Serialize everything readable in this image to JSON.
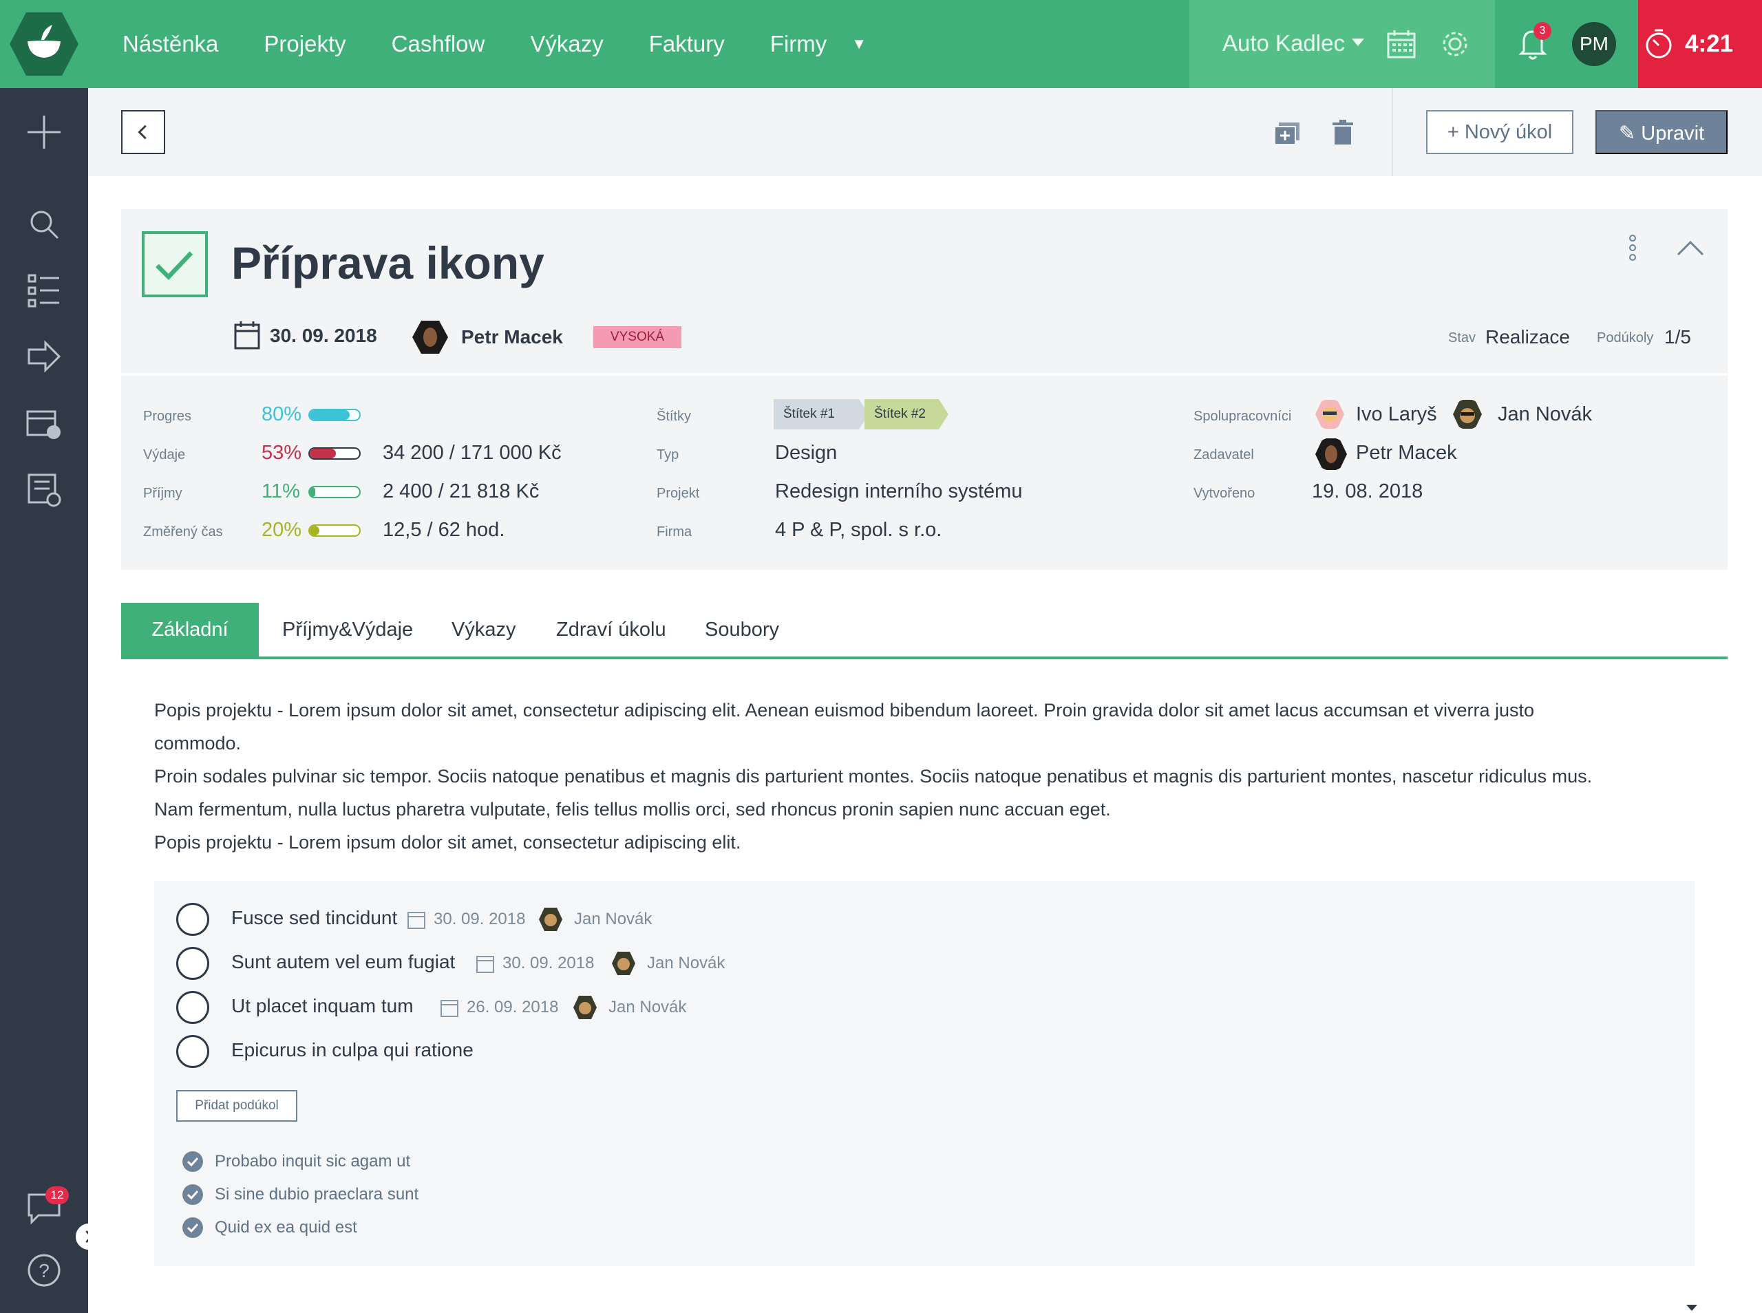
{
  "nav": {
    "items": [
      "Nástěnka",
      "Projekty",
      "Cashflow",
      "Výkazy",
      "Faktury",
      "Firmy"
    ],
    "company": "Auto Kadlec",
    "notifications_count": "3",
    "user_initials": "PM",
    "timer": "4:21"
  },
  "sidebar": {
    "icons": [
      "plus-icon",
      "search-icon",
      "tasks-list-icon",
      "forward-icon",
      "billing-icon",
      "report-icon"
    ],
    "chat_count": "12"
  },
  "toolbar": {
    "new_task_label": "+ Nový úkol",
    "edit_label": "Upravit"
  },
  "task": {
    "title": "Příprava ikony",
    "date": "30. 09. 2018",
    "owner": "Petr Macek",
    "priority": "VYSOKÁ",
    "stav_label": "Stav",
    "stav_value": "Realizace",
    "subtasks_label": "Podúkoly",
    "subtasks_value": "1/5"
  },
  "stats": {
    "progres": {
      "label": "Progres",
      "pct": "80%",
      "fill": 0.8,
      "color": "#3cc3d6"
    },
    "vydaje": {
      "label": "Výdaje",
      "pct": "53%",
      "fill": 0.53,
      "value": "34 200 / 171 000 Kč",
      "color": "#c4314b"
    },
    "prijmy": {
      "label": "Příjmy",
      "pct": "11%",
      "fill": 0.11,
      "value": "2 400 / 21 818 Kč",
      "color": "#3fb07a"
    },
    "cas": {
      "label": "Změřený čas",
      "pct": "20%",
      "fill": 0.2,
      "value": "12,5 / 62 hod.",
      "color": "#a8b420"
    }
  },
  "meta": {
    "stitky_label": "Štítky",
    "tags": [
      "Štítek #1",
      "Štítek #2"
    ],
    "typ_label": "Typ",
    "typ_value": "Design",
    "projekt_label": "Projekt",
    "projekt_value": "Redesign interního systému",
    "firma_label": "Firma",
    "firma_value": "4 P & P, spol. s r.o.",
    "spol_label": "Spolupracovníci",
    "collaborators": [
      "Ivo Laryš",
      "Jan Novák"
    ],
    "zadavatel_label": "Zadavatel",
    "zadavatel_value": "Petr Macek",
    "vytvoreno_label": "Vytvořeno",
    "vytvoreno_value": "19. 08. 2018"
  },
  "tabs": [
    "Základní",
    "Příjmy&Výdaje",
    "Výkazy",
    "Zdraví úkolu",
    "Soubory"
  ],
  "description": [
    "Popis projektu - Lorem ipsum dolor sit amet, consectetur adipiscing elit. Aenean euismod bibendum laoreet. Proin gravida dolor sit amet lacus accumsan et viverra justo",
    "commodo.",
    "Proin sodales pulvinar sic tempor. Sociis natoque penatibus et magnis dis parturient montes. Sociis natoque penatibus et magnis dis parturient montes, nascetur ridiculus mus.",
    "Nam fermentum, nulla luctus pharetra vulputate, felis tellus mollis orci, sed rhoncus pronin sapien nunc accuan eget.",
    "Popis projektu - Lorem ipsum dolor sit amet, consectetur adipiscing elit."
  ],
  "subtasks": [
    {
      "name": "Fusce sed tincidunt",
      "date": "30. 09. 2018",
      "assignee": "Jan Novák"
    },
    {
      "name": "Sunt autem vel eum fugiat",
      "date": "30. 09. 2018",
      "assignee": "Jan Novák"
    },
    {
      "name": "Ut placet inquam tum",
      "date": "26. 09. 2018",
      "assignee": "Jan Novák"
    },
    {
      "name": "Epicurus in culpa qui ratione",
      "date": "",
      "assignee": ""
    }
  ],
  "add_subtask_label": "Přidat podúkol",
  "done_subtasks": [
    "Probabo inquit sic agam ut",
    "Si sine dubio praeclara sunt",
    "Quid ex ea quid est"
  ]
}
